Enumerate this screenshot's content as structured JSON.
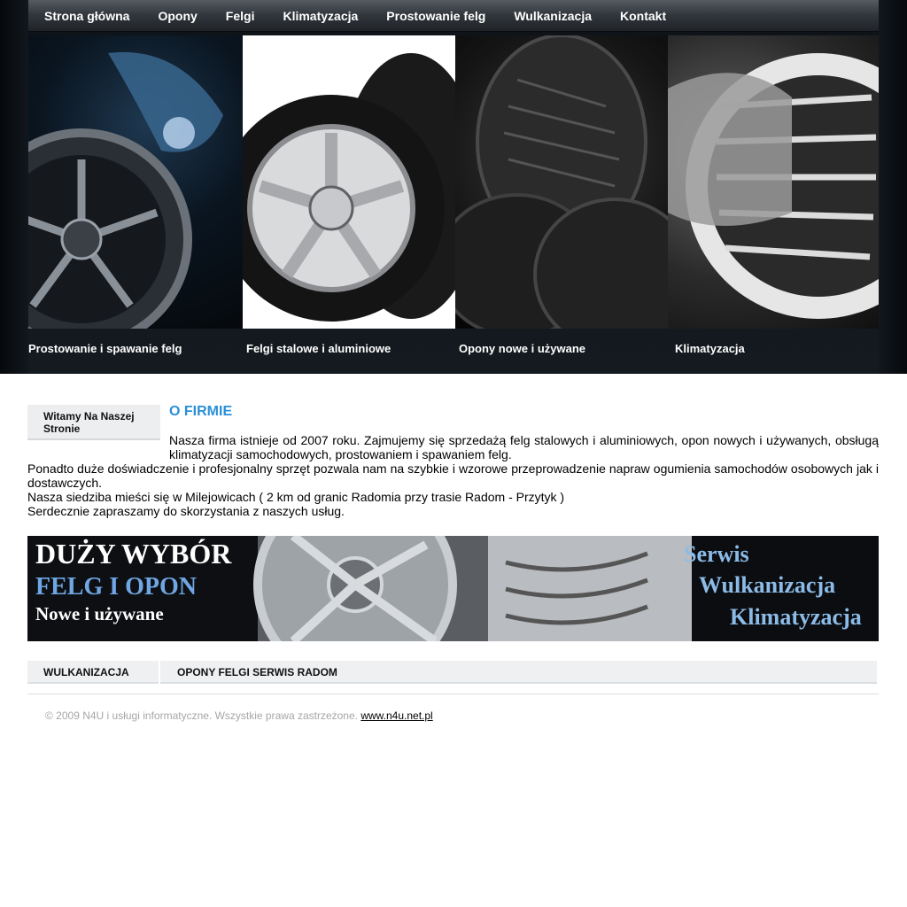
{
  "nav": {
    "items": [
      "Strona główna",
      "Opony",
      "Felgi",
      "Klimatyzacja",
      "Prostowanie felg",
      "Wulkanizacja",
      "Kontakt"
    ]
  },
  "panels": {
    "labels": [
      "Prostowanie i spawanie felg",
      "Felgi stalowe i aluminiowe",
      "Opony nowe i używane",
      "Klimatyzacja"
    ]
  },
  "sidebar": {
    "welcome": "Witamy Na Naszej Stronie"
  },
  "content": {
    "title": "O FIRMIE",
    "para1": "Nasza firma istnieje od 2007 roku. Zajmujemy się sprzedażą  felg stalowych i aluminiowych, opon nowych i używanych, obsługą klimatyzacji samochodowych, prostowaniem i spawaniem felg.",
    "para2": "Ponadto duże doświadczenie i profesjonalny sprzęt pozwala nam na szybkie i wzorowe przeprowadzenie napraw ogumienia samochodów osobowych jak i dostawczych.",
    "para3": "Nasza siedziba mieści się w Milejowicach ( 2 km od granic Radomia przy trasie Radom - Przytyk )",
    "para4": "Serdecznie zapraszamy do skorzystania z naszych usług."
  },
  "promo": {
    "line1": "DUŻY WYBÓR",
    "line2": "FELG I OPON",
    "line3": "Nowe i używane",
    "right1": "Serwis",
    "right2": "Wulkanizacja",
    "right3": "Klimatyzacja"
  },
  "footer": {
    "tab1": "WULKANIZACJA",
    "tab2": "OPONY FELGI SERWIS RADOM",
    "copyright": "© 2009 N4U i usługi informatyczne. Wszystkie prawa zastrzeżone.",
    "link": "www.n4u.net.pl"
  }
}
